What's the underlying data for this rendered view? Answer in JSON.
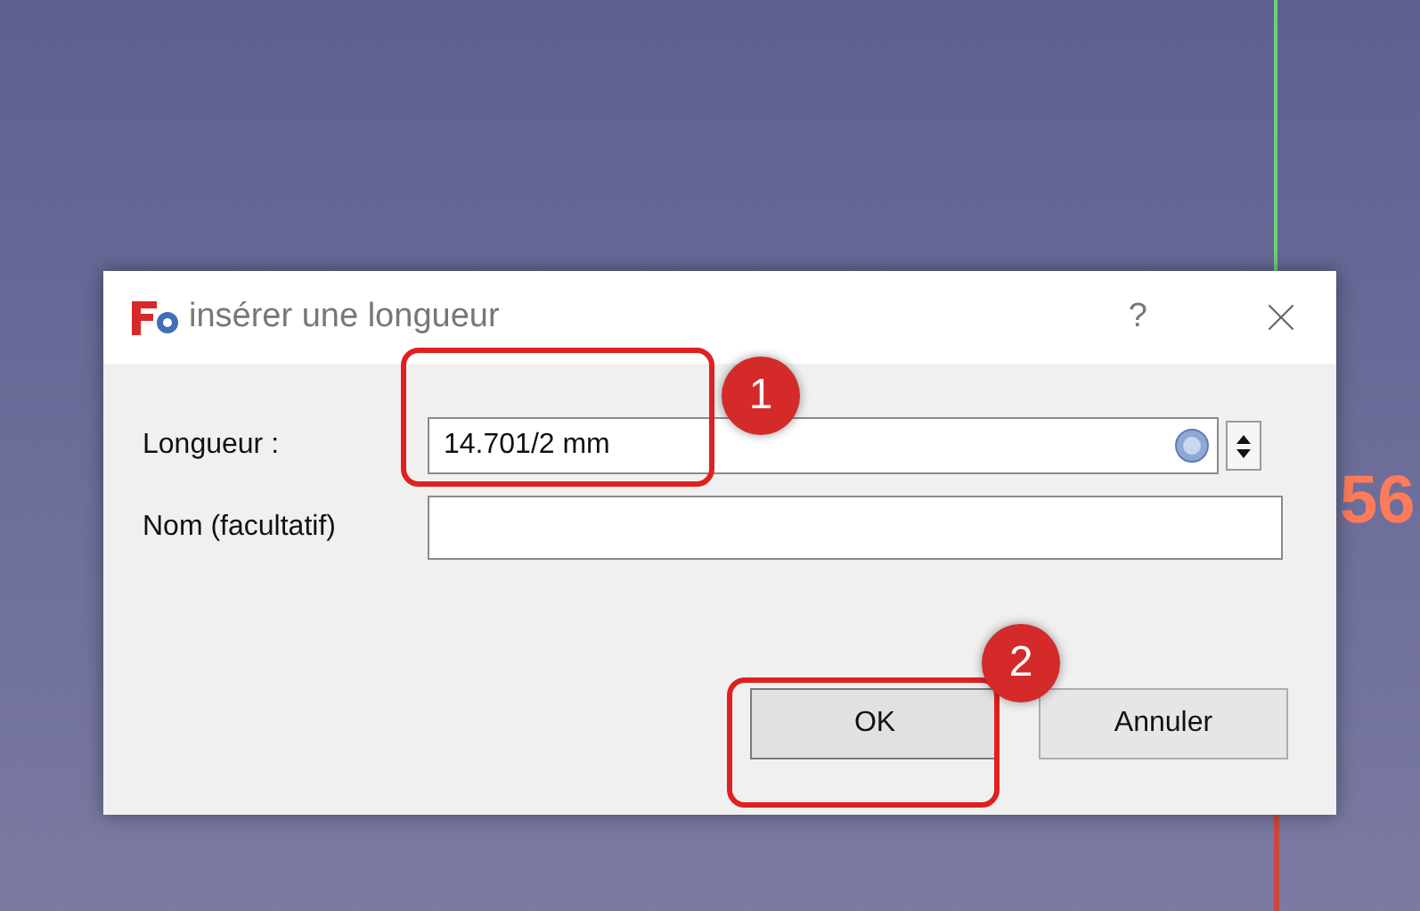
{
  "canvas": {
    "dimension_label": "56"
  },
  "dialog": {
    "title": "insérer une longueur",
    "help": "?",
    "fields": [
      {
        "kind": "quantity",
        "label": "Longueur :",
        "value": "14.701/2 mm"
      },
      {
        "kind": "text",
        "label": "Nom (facultatif)"
      }
    ],
    "buttons": [
      {
        "label": "OK",
        "default": true
      },
      {
        "label": "Annuler",
        "default": false
      }
    ]
  },
  "annotations": [
    {
      "number": "1"
    },
    {
      "number": "2"
    }
  ]
}
